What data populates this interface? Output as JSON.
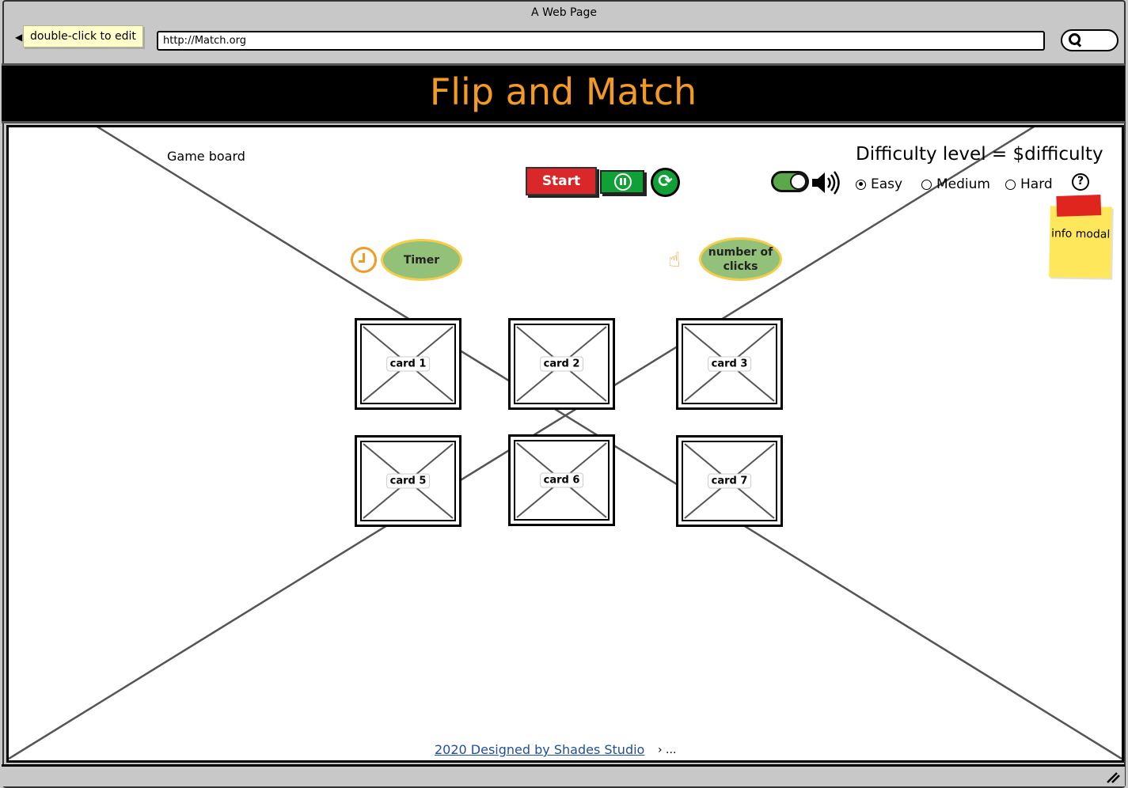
{
  "window": {
    "title": "A Web Page",
    "tooltip": "double-click to edit",
    "url": "http://Match.org"
  },
  "header": {
    "title": "Flip and Match",
    "title_color": "#f29a24",
    "background": "#000000"
  },
  "board": {
    "label": "Game board"
  },
  "controls": {
    "start_label": "Start",
    "pause_icon": "pause-icon",
    "refresh_icon": "refresh-icon",
    "sound_toggle_on": true,
    "speaker_icon": "speaker-icon"
  },
  "difficulty": {
    "title": "Difficulty level = $difficulty",
    "options": [
      "Easy",
      "Medium",
      "Hard"
    ],
    "selected": "Easy",
    "help_icon": "help-icon"
  },
  "stats": {
    "timer_label": "Timer",
    "timer_icon": "clock-icon",
    "clicks_label": "number of clicks",
    "clicks_icon": "hand-click-icon"
  },
  "info_note": {
    "text": "info modal"
  },
  "cards": [
    {
      "label": "card 1"
    },
    {
      "label": "card 2"
    },
    {
      "label": "card 3"
    },
    {
      "label": "card 5"
    },
    {
      "label": "card 6"
    },
    {
      "label": "card 7"
    }
  ],
  "footer": {
    "link_text": "2020  Designed by Shades Studio",
    "more": "› ..."
  },
  "colors": {
    "start_red": "#d9272a",
    "action_green": "#11a035",
    "pill_green": "#93c17a",
    "pill_border": "#f6cd48",
    "sticky_yellow": "#ffe75c"
  }
}
